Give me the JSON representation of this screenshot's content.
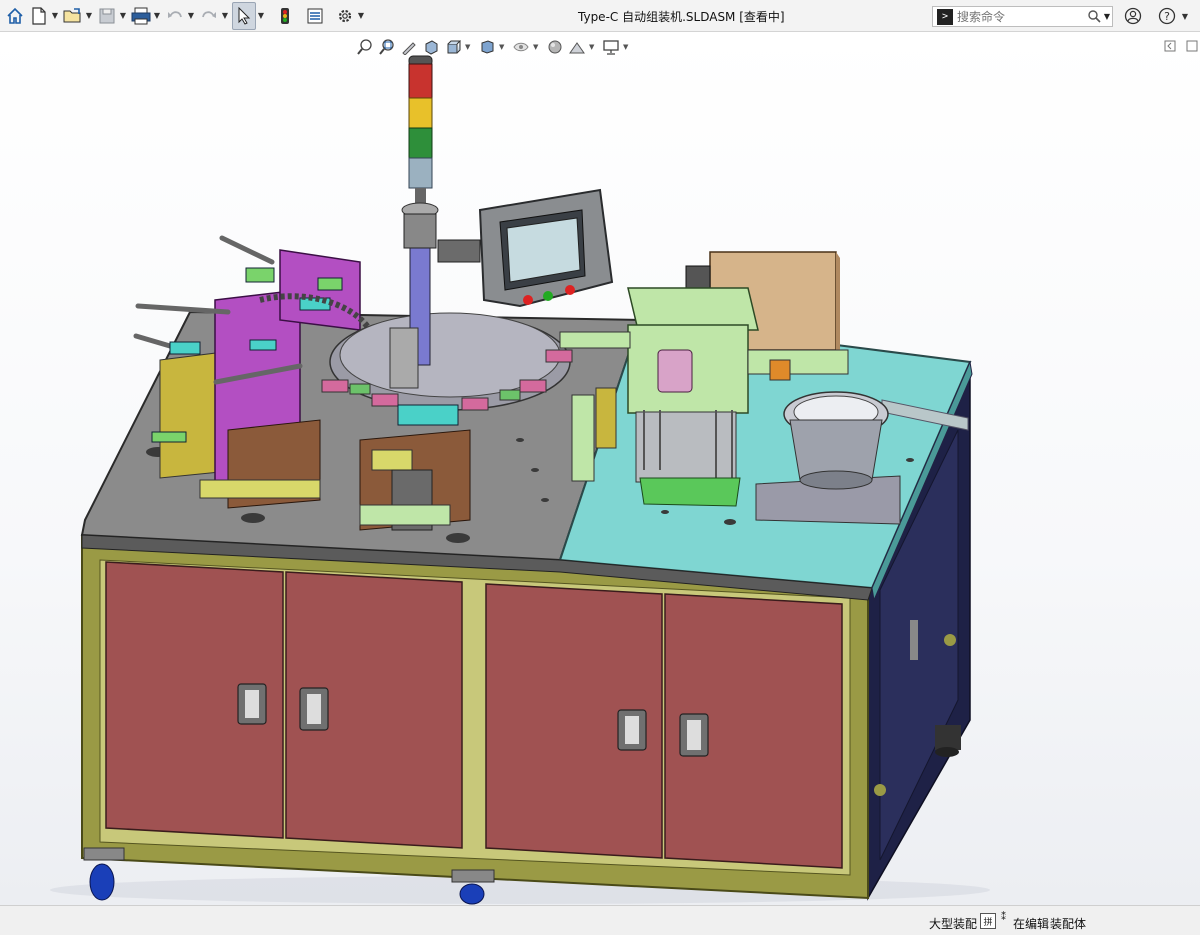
{
  "window": {
    "title": "Type-C 自动组装机.SLDASM [查看中]"
  },
  "toolbar": {
    "icons": [
      "home-icon",
      "new-document-icon",
      "open-icon",
      "save-icon",
      "print-icon",
      "undo-icon",
      "redo-icon",
      "select-icon",
      "traffic-light-icon",
      "file-properties-icon",
      "options-gear-icon"
    ]
  },
  "search": {
    "placeholder": "搜索命令"
  },
  "hud": {
    "icons": [
      "zoom-to-fit-icon",
      "zoom-to-area-icon",
      "previous-view-icon",
      "section-view-icon",
      "view-orientation-icon",
      "display-style-icon",
      "hide-show-icon",
      "edit-appearance-icon",
      "apply-scene-icon",
      "view-settings-icon"
    ]
  },
  "statusbar": {
    "mode": "大型装配",
    "box_label": "拼",
    "editing": "在编辑",
    "document_type": "装配体"
  },
  "colors": {
    "cabinet_frame": "#9a9a45",
    "cabinet_door": "#a05252",
    "table_top_grey": "#8b8b8b",
    "table_top_cyan": "#7fd6d2",
    "machine_purple": "#b34fc2",
    "machine_green": "#bfe6a8",
    "hopper_tan": "#d6b48a"
  }
}
